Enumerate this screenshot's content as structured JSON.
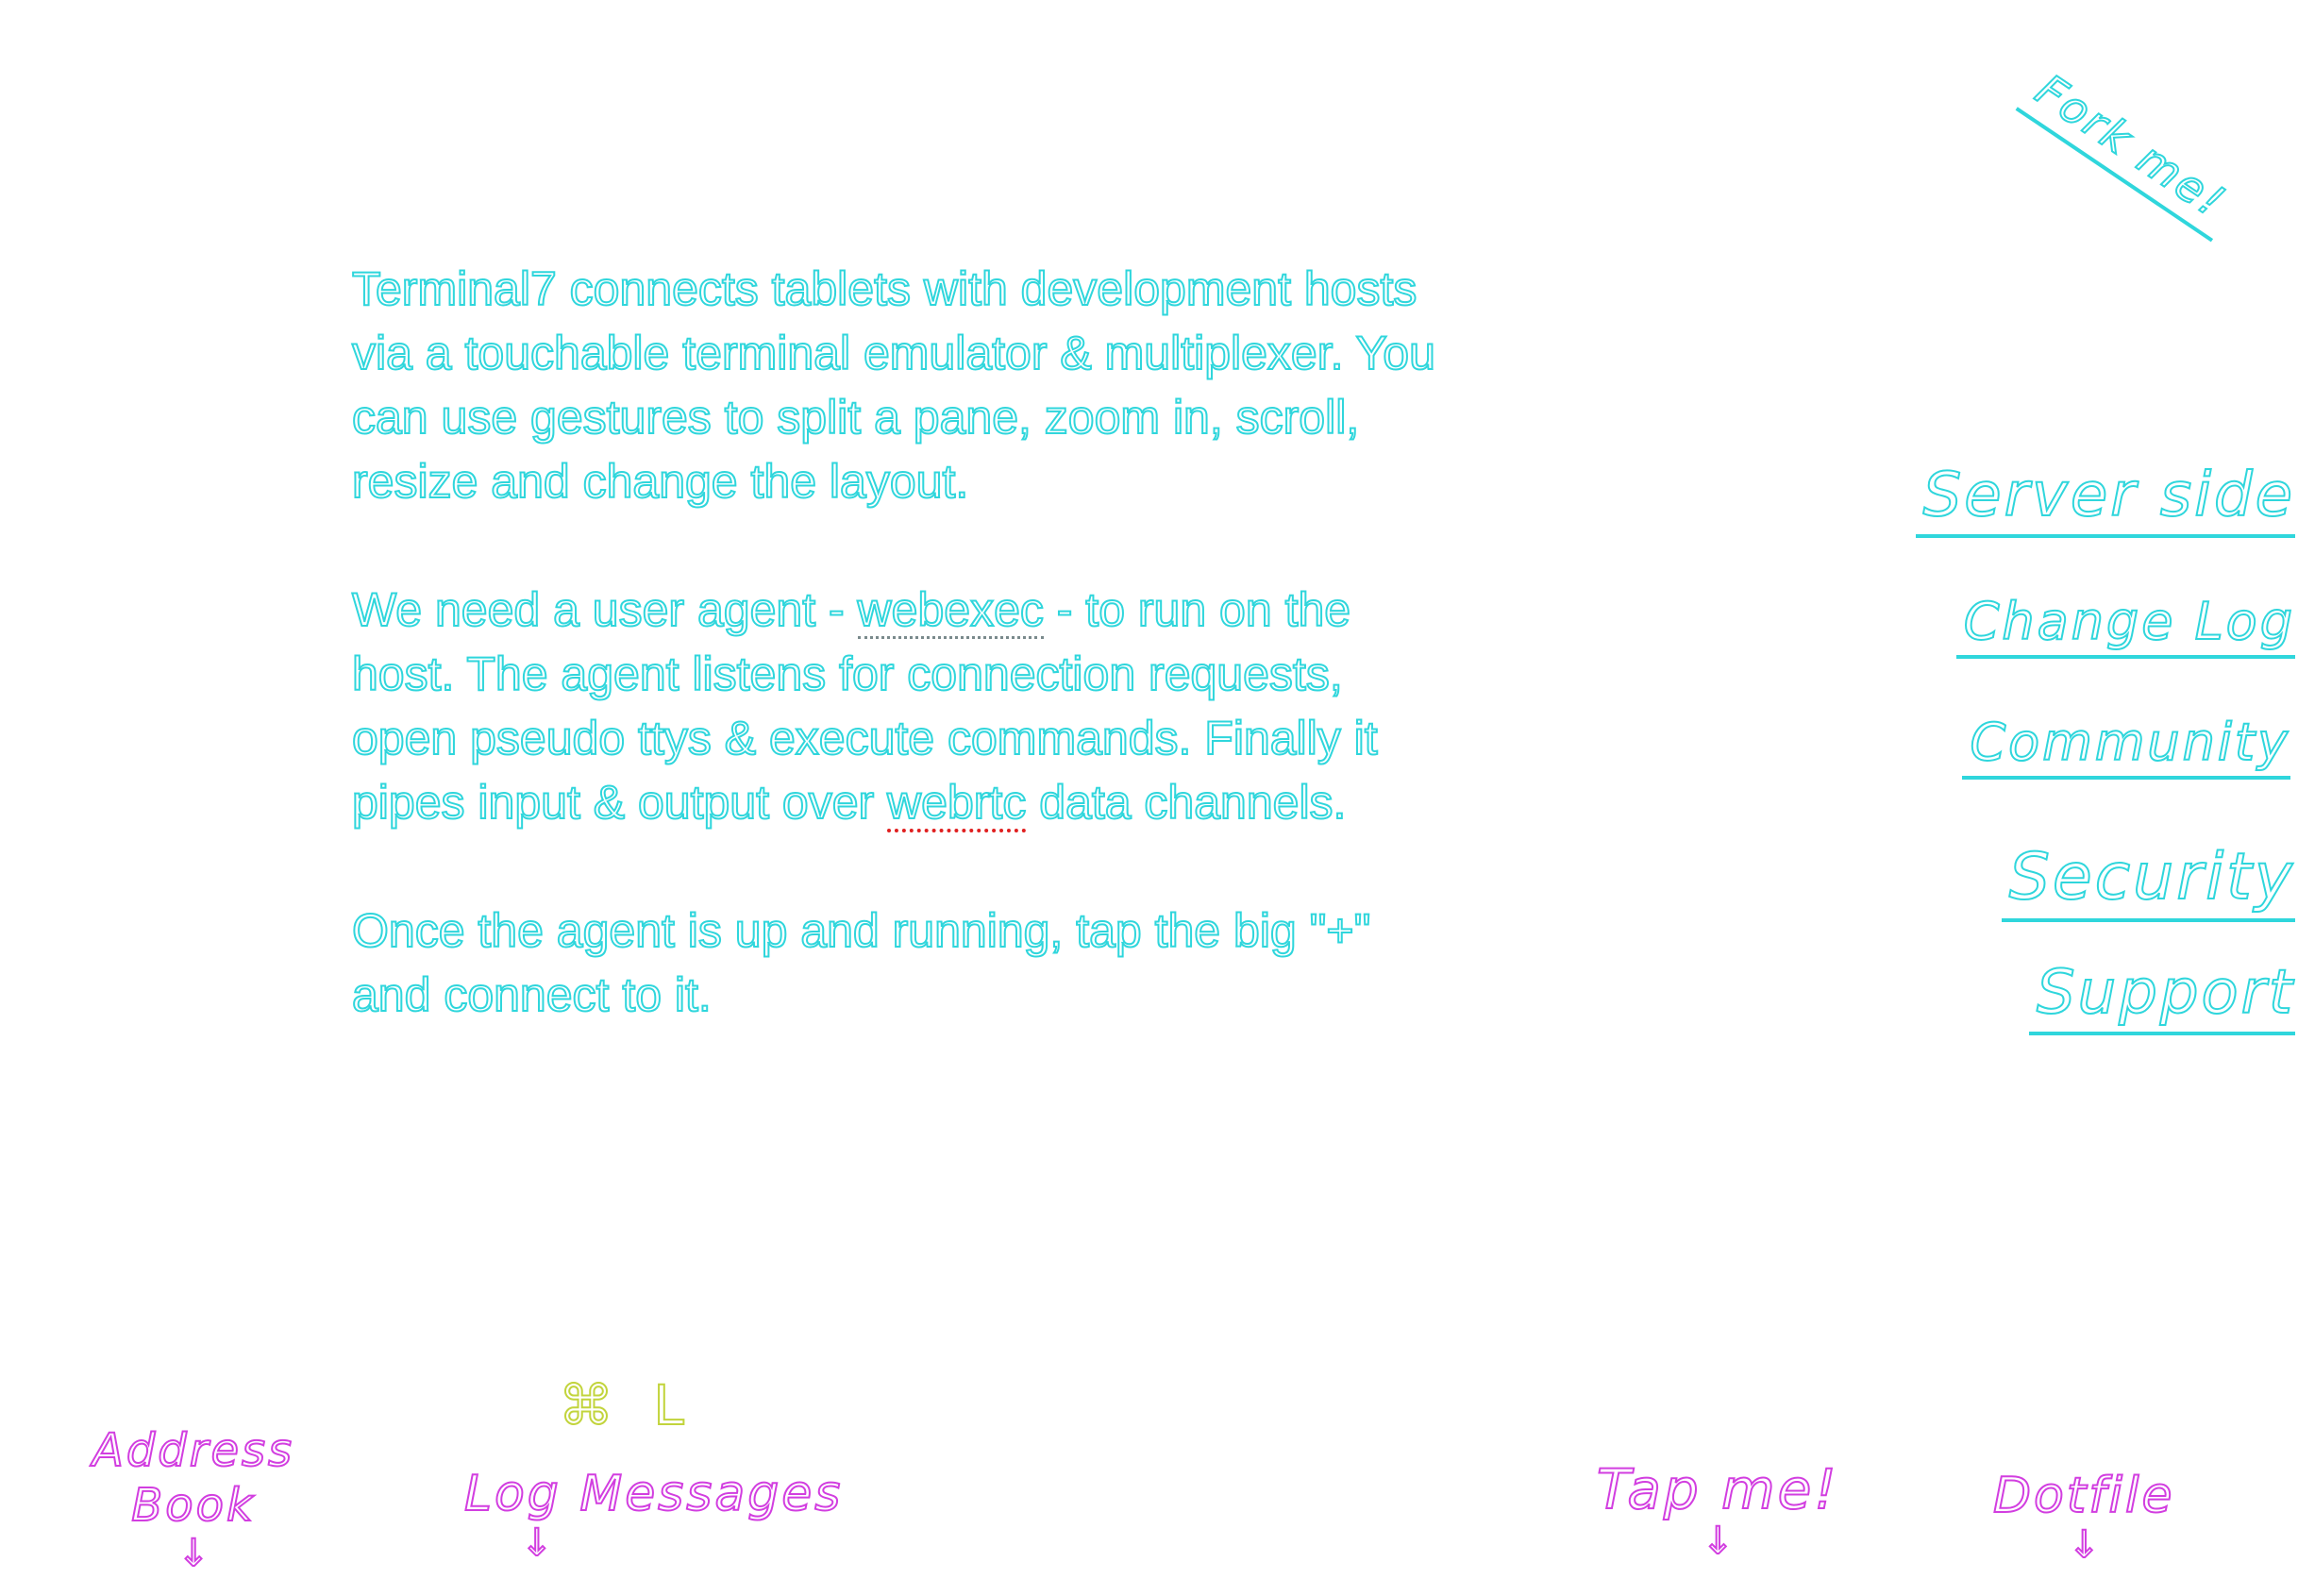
{
  "intro": {
    "p1": "Terminal7 connects tablets with development hosts via a touchable terminal emulator & multiplexer. You can use gestures to split a pane, zoom in, scroll, resize and change the layout.",
    "p2_before": "We need a user agent - ",
    "p2_link": "webexec",
    "p2_middle": " - to run on the host. The agent listens for connection requests, open pseudo ttys & execute commands. Finally it pipes input & output over ",
    "p2_link2": "webrtc",
    "p2_after": " data channels.",
    "p3": "Once the agent is up and running, tap the big \"+\" and connect to it."
  },
  "fork": {
    "label": "Fork me!"
  },
  "nav": {
    "server_side": "Server side",
    "change_log": "Change Log",
    "community": "Community",
    "security": "Security",
    "support": "Support"
  },
  "labels": {
    "address_book_line1": "Address",
    "address_book_line2": "Book",
    "log_messages": "Log Messages",
    "log_shortcut": "⌘ L",
    "tap_me": "Tap me!",
    "dotfile": "Dotfile",
    "arrow": "↓"
  },
  "colors": {
    "cyan": "#2fd6dc",
    "magenta": "#d23ee0",
    "lime": "#c2d43c"
  }
}
